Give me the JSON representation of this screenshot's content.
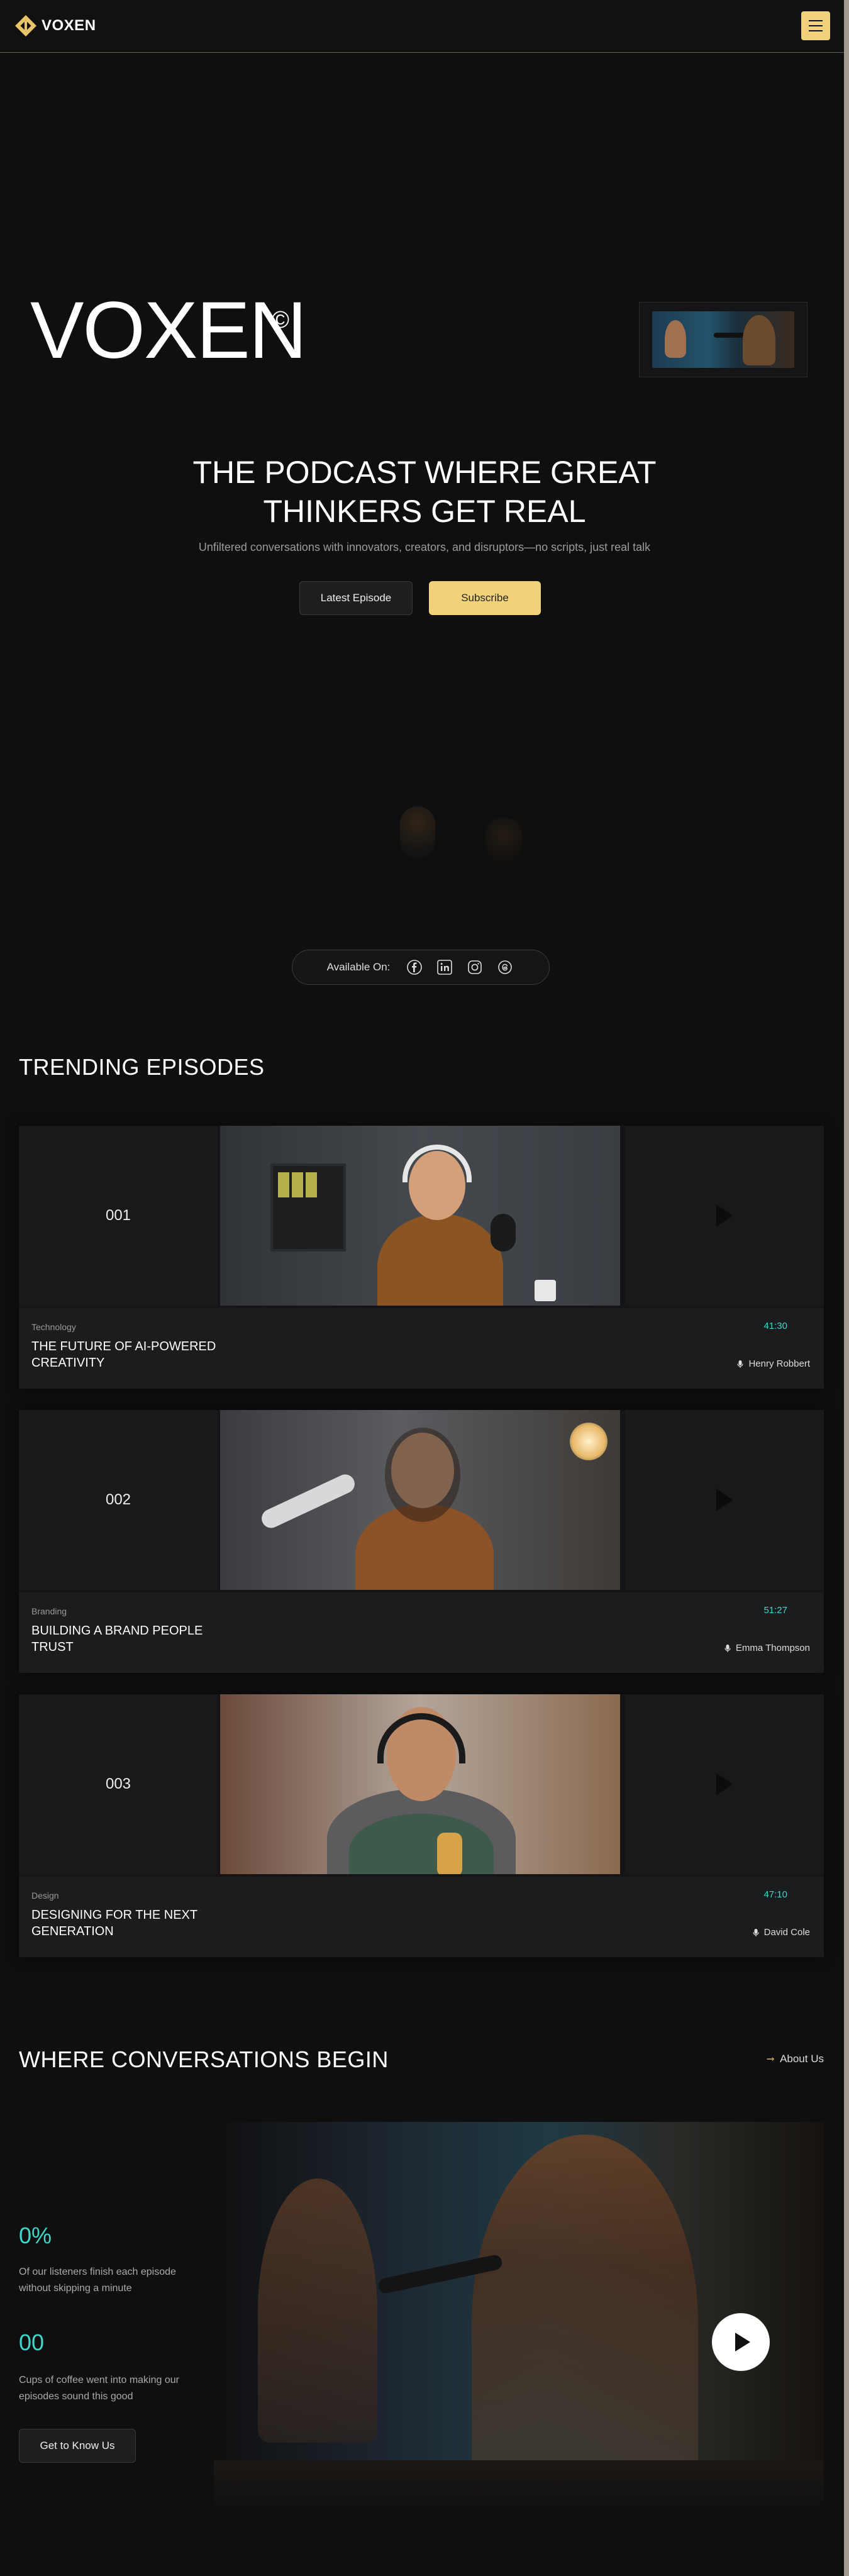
{
  "header": {
    "logo_text": "VOXEN",
    "menu_icon": "hamburger-icon",
    "accent": "#f1d27a"
  },
  "hero": {
    "title": "VOXEN",
    "copyright": "©",
    "headline_line1": "THE PODCAST WHERE GREAT",
    "headline_line2": "THINKERS GET REAL",
    "subheadline": "Unfiltered conversations with innovators, creators, and disruptors—no scripts, just real talk",
    "latest_button": "Latest Episode",
    "subscribe_button": "Subscribe"
  },
  "available": {
    "label": "Available On:",
    "platforms": [
      "facebook-icon",
      "linkedin-icon",
      "instagram-icon",
      "threads-icon"
    ]
  },
  "trending": {
    "title": "TRENDING EPISODES",
    "episodes": [
      {
        "number": "001",
        "category": "Technology",
        "title": "THE FUTURE OF AI-POWERED CREATIVITY",
        "duration": "41:30",
        "host": "Henry Robbert"
      },
      {
        "number": "002",
        "category": "Branding",
        "title": "BUILDING A BRAND PEOPLE TRUST",
        "duration": "51:27",
        "host": "Emma Thompson"
      },
      {
        "number": "003",
        "category": "Design",
        "title": "DESIGNING FOR THE NEXT GENERATION",
        "duration": "47:10",
        "host": "David Cole"
      }
    ]
  },
  "conversations": {
    "title": "WHERE CONVERSATIONS BEGIN",
    "about_link": "About Us",
    "stat1_value": "0%",
    "stat1_desc": "Of our listeners finish each episode without skipping a minute",
    "stat2_value": "00",
    "stat2_desc": "Cups of coffee went into making our episodes sound this good",
    "cta": "Get to Know Us"
  },
  "colors": {
    "background": "#0f0f10",
    "accent_yellow": "#f1d27a",
    "accent_teal": "#3fd7c9"
  }
}
